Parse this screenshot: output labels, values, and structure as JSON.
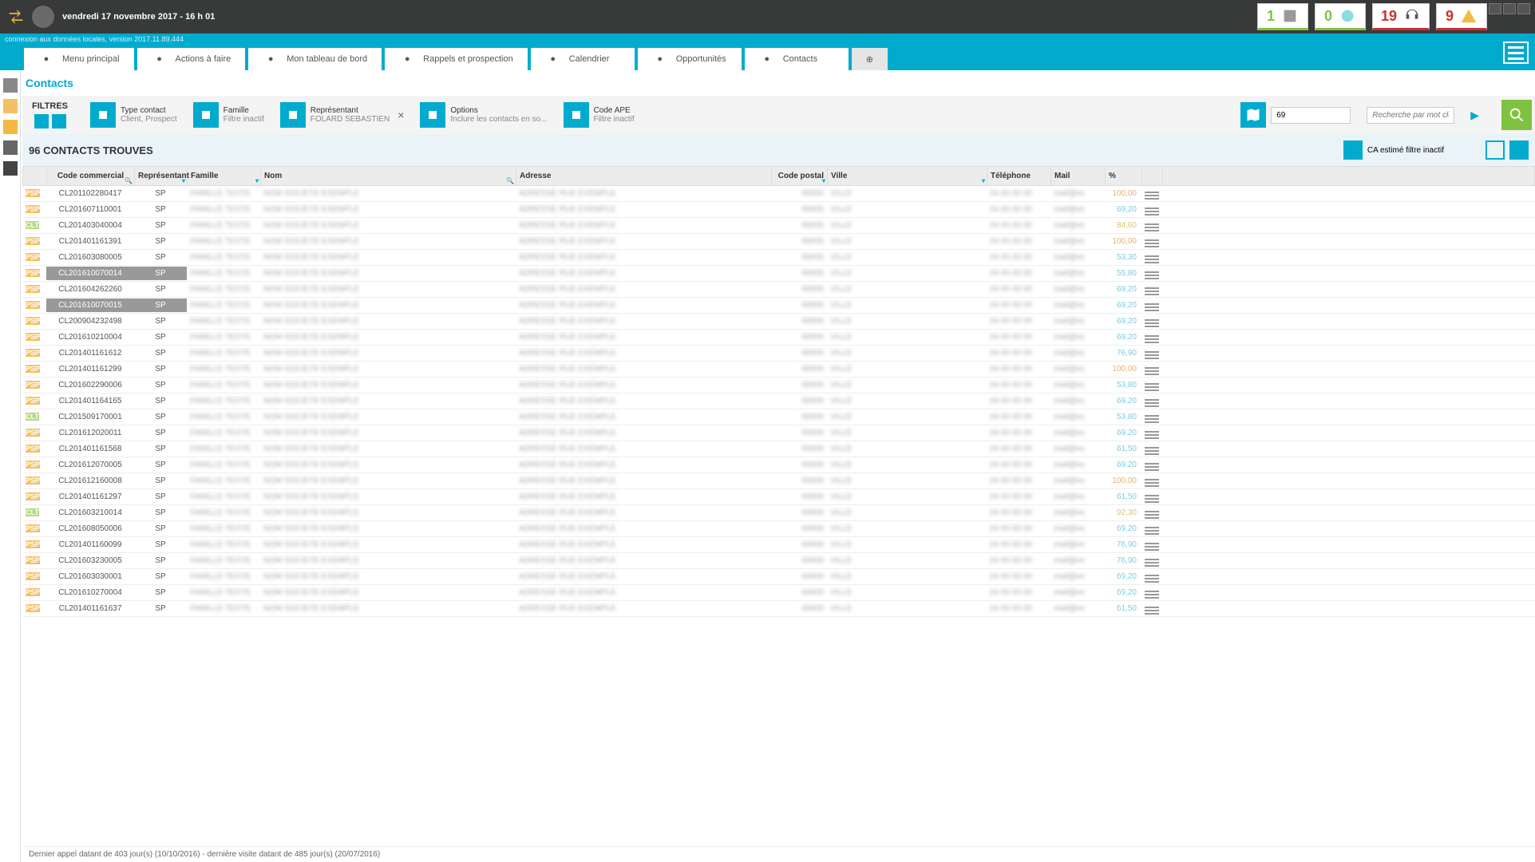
{
  "header": {
    "date": "vendredi 17 novembre 2017 - 16 h 01",
    "connexion": "connexion aux données locales, version 2017.11.89.444",
    "stats": [
      {
        "n": "1",
        "cls": "g",
        "icon": "news"
      },
      {
        "n": "0",
        "cls": "g",
        "icon": "chat"
      },
      {
        "n": "19",
        "cls": "r",
        "icon": "headset"
      },
      {
        "n": "9",
        "cls": "r",
        "icon": "warn"
      }
    ]
  },
  "tabs": [
    {
      "label": "Menu principal",
      "icon": "home"
    },
    {
      "label": "Actions à faire",
      "icon": "note"
    },
    {
      "label": "Mon tableau de bord",
      "icon": "dash"
    },
    {
      "label": "Rappels et prospection",
      "icon": "headset"
    },
    {
      "label": "Calendrier",
      "icon": "cal"
    },
    {
      "label": "Opportunités",
      "icon": "star"
    },
    {
      "label": "Contacts",
      "icon": "contact"
    }
  ],
  "title": "Contacts",
  "filters": {
    "label": "FILTRES",
    "items": [
      {
        "title": "Type contact",
        "sub": "Client, Prospect"
      },
      {
        "title": "Famille",
        "sub": "Filtre inactif"
      },
      {
        "title": "Représentant",
        "sub": "FOLARD SEBASTIEN",
        "close": true
      },
      {
        "title": "Options",
        "sub": "Inclure les contacts en so..."
      },
      {
        "title": "Code APE",
        "sub": "Filtre inactif"
      }
    ],
    "input": "69",
    "search_placeholder": "Recherche par mot clé"
  },
  "count": {
    "text": "96 CONTACTS TROUVES",
    "ca": "CA estimé filtre inactif"
  },
  "columns": [
    "",
    "Code commercial",
    "Représentant",
    "Famille",
    "Nom",
    "Adresse",
    "Code postal",
    "Ville",
    "Téléphone",
    "Mail",
    "%",
    ""
  ],
  "rows": [
    {
      "tag": "PSP",
      "code": "CL201102280417",
      "rep": "SP",
      "pct": "100,00",
      "pcls": "o"
    },
    {
      "tag": "PSP",
      "code": "CL201607110001",
      "rep": "SP",
      "pct": "69,20"
    },
    {
      "tag": "CLT",
      "code": "CL201403040004",
      "rep": "SP",
      "pct": "84,60",
      "pcls": "y"
    },
    {
      "tag": "PSP",
      "code": "CL201401161391",
      "rep": "SP",
      "pct": "100,00",
      "pcls": "o"
    },
    {
      "tag": "PSP",
      "code": "CL201603080005",
      "rep": "SP",
      "pct": "53,30"
    },
    {
      "tag": "PSP",
      "code": "CL201610070014",
      "rep": "SP",
      "pct": "55,80",
      "sel": true
    },
    {
      "tag": "PSP",
      "code": "CL201604262260",
      "rep": "SP",
      "pct": "69,20"
    },
    {
      "tag": "PSP",
      "code": "CL201610070015",
      "rep": "SP",
      "pct": "69,20",
      "sel": true
    },
    {
      "tag": "PSP",
      "code": "CL200904232498",
      "rep": "SP",
      "pct": "69,20"
    },
    {
      "tag": "PSP",
      "code": "CL201610210004",
      "rep": "SP",
      "pct": "69,20"
    },
    {
      "tag": "PSP",
      "code": "CL201401161612",
      "rep": "SP",
      "pct": "76,90"
    },
    {
      "tag": "PSP",
      "code": "CL201401161299",
      "rep": "SP",
      "pct": "100,00",
      "pcls": "o"
    },
    {
      "tag": "PSP",
      "code": "CL201602290006",
      "rep": "SP",
      "pct": "53,80"
    },
    {
      "tag": "PSP",
      "code": "CL201401164165",
      "rep": "SP",
      "pct": "69,20"
    },
    {
      "tag": "CLT",
      "code": "CL201509170001",
      "rep": "SP",
      "pct": "53,80"
    },
    {
      "tag": "PSP",
      "code": "CL201612020011",
      "rep": "SP",
      "pct": "69,20"
    },
    {
      "tag": "PSP",
      "code": "CL201401161568",
      "rep": "SP",
      "pct": "61,50"
    },
    {
      "tag": "PSP",
      "code": "CL201612070005",
      "rep": "SP",
      "pct": "69,20"
    },
    {
      "tag": "PSP",
      "code": "CL201612160008",
      "rep": "SP",
      "pct": "100,00",
      "pcls": "o"
    },
    {
      "tag": "PSP",
      "code": "CL201401161297",
      "rep": "SP",
      "pct": "61,50"
    },
    {
      "tag": "CLT",
      "code": "CL201603210014",
      "rep": "SP",
      "pct": "92,30",
      "pcls": "y"
    },
    {
      "tag": "PSP",
      "code": "CL201608050006",
      "rep": "SP",
      "pct": "69,20"
    },
    {
      "tag": "PSP",
      "code": "CL201401160099",
      "rep": "SP",
      "pct": "76,90"
    },
    {
      "tag": "PSP",
      "code": "CL201603230005",
      "rep": "SP",
      "pct": "76,90"
    },
    {
      "tag": "PSP",
      "code": "CL201603030001",
      "rep": "SP",
      "pct": "69,20"
    },
    {
      "tag": "PSP",
      "code": "CL201610270004",
      "rep": "SP",
      "pct": "69,20"
    },
    {
      "tag": "PSP",
      "code": "CL201401161637",
      "rep": "SP",
      "pct": "61,50"
    }
  ],
  "footer": "Dernier appel datant de 403 jour(s)  (10/10/2016)  -  dernière visite datant de 485 jour(s)  (20/07/2016)"
}
